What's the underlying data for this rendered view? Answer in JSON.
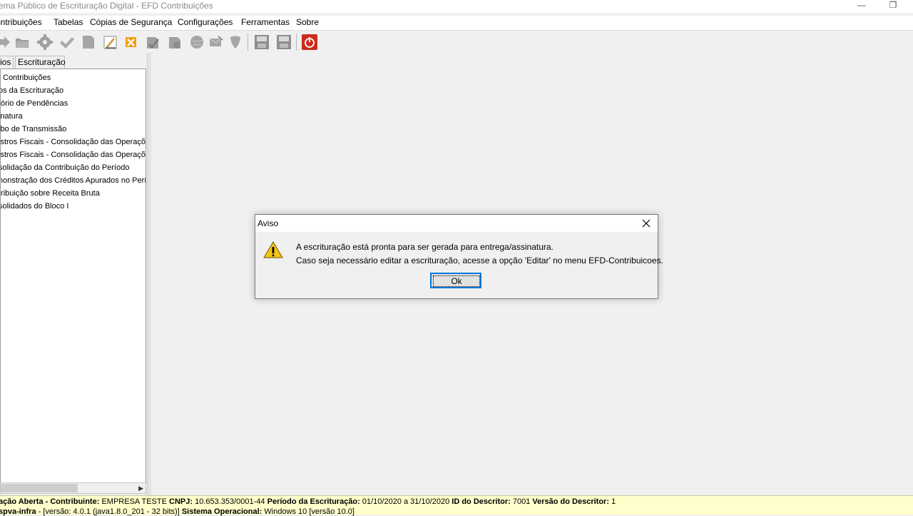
{
  "window": {
    "title": "ema Público de Escrituração Digital - EFD Contribuições",
    "minimize_glyph": "—",
    "restore_glyph": "❐"
  },
  "menu": [
    "ontribuições",
    "Tabelas",
    "Cópias de Segurança",
    "Configurações",
    "Ferramentas",
    "Sobre"
  ],
  "toolbar": {
    "icons": [
      "arrow-right-icon",
      "folder-open-icon",
      "gear-icon",
      "check-icon",
      "document-icon",
      "edit-document-icon",
      "close-icon",
      "sign-icon",
      "transmit-icon",
      "globe-icon",
      "mail-icon",
      "shield-icon",
      "backup-icon",
      "restore-icon",
      "exit-icon"
    ],
    "exit_color": "#cc2b1d"
  },
  "left_panel": {
    "tabs": [
      "ios",
      "Escrituração"
    ],
    "tree": [
      "Contribuições",
      "os da Escrituração",
      "tório de Pendências",
      "inatura",
      "ibo de Transmissão",
      "istros Fiscais - Consolidação das Operaçõ",
      "istros Fiscais - Consolidação das Operaçõ",
      "solidação da Contribuição do Período",
      "nonstração dos Créditos Apurados no Perí",
      "tribuição sobre Receita Bruta",
      "solidados do Bloco I"
    ]
  },
  "dialog": {
    "title": "Aviso",
    "icon": "warning-icon",
    "line1": "A escrituração está pronta para ser gerada para entrega/assinatura.",
    "line2": "Caso seja necessário editar a escrituração, acesse a opção 'Editar' no menu EFD-Contribuicoes.",
    "ok_label": "Ok"
  },
  "status": {
    "l1_k1": "ação Aberta - Contribuinte:",
    "l1_v1": " EMPRESA TESTE ",
    "l1_k2": "CNPJ:",
    "l1_v2": " 10.653.353/0001-44 ",
    "l1_k3": "Período da Escrituração:",
    "l1_v3": " 01/10/2020 a 31/10/2020 ",
    "l1_k4": "ID do Descritor:",
    "l1_v4": " 7001 ",
    "l1_k5": "Versão do Descritor:",
    "l1_v5": " 1",
    "l2_k1": "spva-infra",
    "l2_v1": " - [versão: 4.0.1 (java1.8.0_201 - 32 bits)] ",
    "l2_k2": "Sistema Operacional:",
    "l2_v2": " Windows 10 [versão 10.0]"
  }
}
